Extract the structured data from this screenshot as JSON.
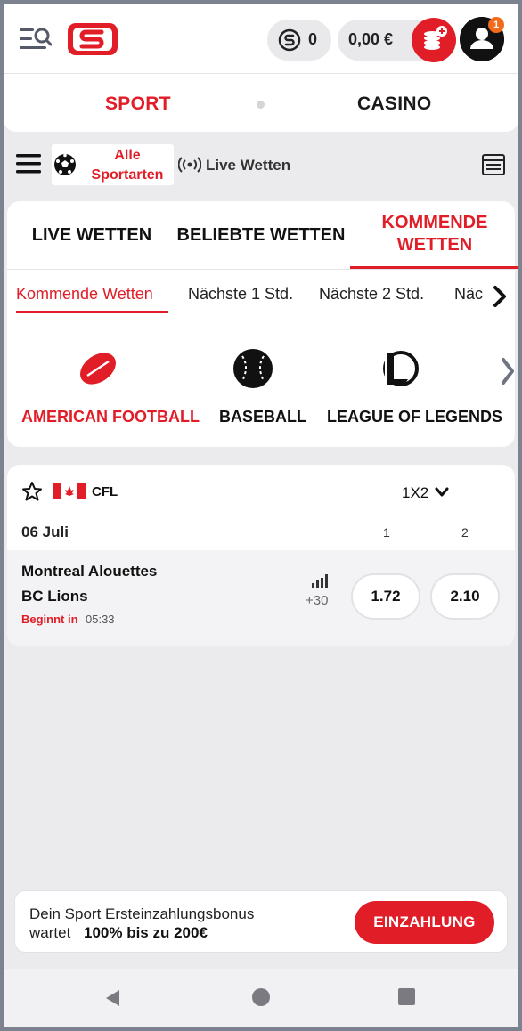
{
  "header": {
    "coins": "0",
    "balance": "0,00 €",
    "notifications": "1"
  },
  "mode": {
    "sport": "SPORT",
    "casino": "CASINO"
  },
  "filter": {
    "sport_select": "Alle Sportarten",
    "live_label": "Live Wetten"
  },
  "tabs": [
    {
      "label": "LIVE WETTEN"
    },
    {
      "label": "BELIEBTE WETTEN"
    },
    {
      "label": "KOMMENDE WETTEN"
    }
  ],
  "time_filters": [
    {
      "label": "Kommende Wetten"
    },
    {
      "label": "Nächste 1 Std."
    },
    {
      "label": "Nächste 2 Std."
    },
    {
      "label": "Näc"
    }
  ],
  "sports": [
    {
      "label": "AMERICAN FOOTBALL",
      "icon": "american-football-icon"
    },
    {
      "label": "BASEBALL",
      "icon": "baseball-icon"
    },
    {
      "label": "LEAGUE OF LEGENDS",
      "icon": "league-of-legends-icon"
    }
  ],
  "event_card": {
    "league": "CFL",
    "market": "1X2",
    "date": "06 Juli",
    "col1": "1",
    "col2": "2",
    "home_team": "Montreal Alouettes",
    "away_team": "BC Lions",
    "starts_label": "Beginnt in",
    "starts_time": "05:33",
    "more_markets": "+30",
    "odd1": "1.72",
    "odd2": "2.10"
  },
  "bonus": {
    "line1": "Dein Sport Ersteinzahlungsbonus",
    "line2_a": "wartet",
    "line2_b": "100% bis zu 200€",
    "button": "EINZAHLUNG"
  },
  "colors": {
    "brand_red": "#e11d27",
    "badge_orange": "#f26a1b"
  }
}
